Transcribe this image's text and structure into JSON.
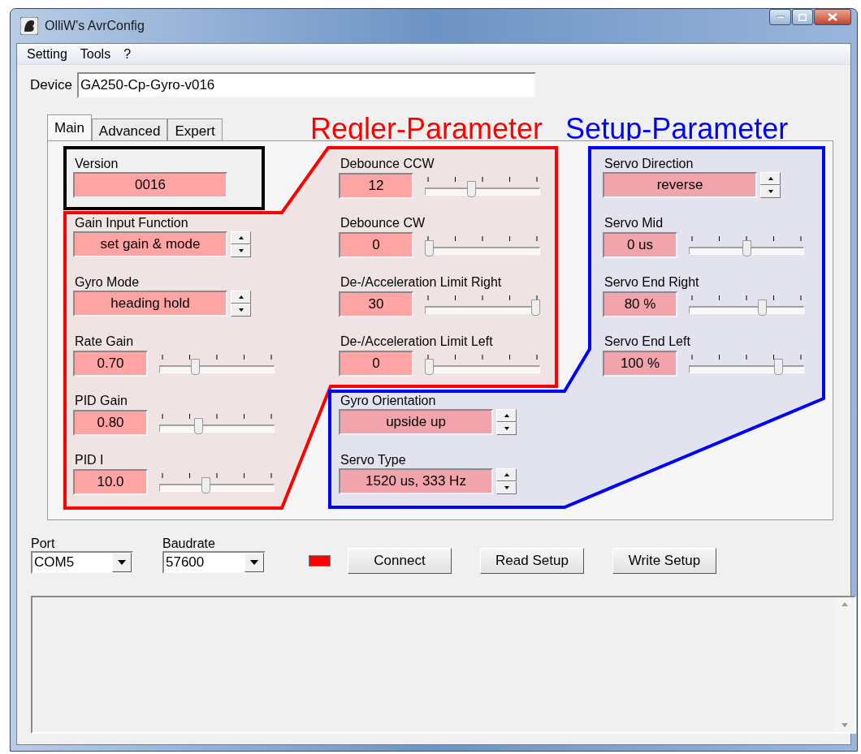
{
  "window": {
    "title": "OlliW's AvrConfig"
  },
  "menu": [
    "Setting",
    "Tools",
    "?"
  ],
  "device": {
    "label": "Device",
    "value": "GA250-Cp-Gyro-v016"
  },
  "tabs": [
    {
      "label": "Main",
      "selected": true
    },
    {
      "label": "Advanced",
      "selected": false
    },
    {
      "label": "Expert",
      "selected": false
    }
  ],
  "annotations": [
    {
      "text": "Regler-Parameter",
      "color": "#ff0000"
    },
    {
      "text": "Setup-Parameter",
      "color": "#0000ff"
    }
  ],
  "columns": [
    [
      {
        "label": "Version",
        "value": "0016",
        "kind": "display",
        "color": "#ffa4a4"
      },
      {
        "label": "Gain Input Function",
        "value": "set gain & mode",
        "kind": "spin",
        "color": "#ffa4a4"
      },
      {
        "label": "Gyro Mode",
        "value": "heading hold",
        "kind": "spin",
        "color": "#ffa4a4"
      },
      {
        "label": "Rate Gain",
        "value": "0.70",
        "kind": "slider",
        "level": 0.3,
        "color": "#ffa4a4"
      },
      {
        "label": "PID Gain",
        "value": "0.80",
        "kind": "slider",
        "level": 0.33,
        "color": "#ffa4a4"
      },
      {
        "label": "PID I",
        "value": "10.0",
        "kind": "slider",
        "level": 0.4,
        "color": "#ffa4a4"
      }
    ],
    [
      {
        "label": "Debounce CCW",
        "value": "12",
        "kind": "slider",
        "level": 0.4,
        "color": "#ffa4a4"
      },
      {
        "label": "Debounce CW",
        "value": "0",
        "kind": "slider",
        "level": 0,
        "color": "#ffa4a4"
      },
      {
        "label": "De-/Acceleration Limit Right",
        "value": "30",
        "kind": "slider",
        "level": 1,
        "color": "#ffa4a4"
      },
      {
        "label": "De-/Acceleration Limit Left",
        "value": "0",
        "kind": "slider",
        "level": 0,
        "color": "#ffa4a4"
      },
      {
        "label": "Gyro Orientation",
        "value": "upside up",
        "kind": "spin",
        "color": "#f2a4ac"
      },
      {
        "label": "Servo Type",
        "value": "1520 us, 333 Hz",
        "kind": "spin",
        "color": "#f2a4ac"
      }
    ],
    [
      {
        "label": "Servo Direction",
        "value": "reverse",
        "kind": "spin",
        "color": "#f2a4ac"
      },
      {
        "label": "Servo Mid",
        "value": "0 us",
        "kind": "slider",
        "level": 0.5,
        "color": "#f2a4ac"
      },
      {
        "label": "Servo End Right",
        "value": "80 %",
        "kind": "slider",
        "level": 0.65,
        "color": "#f2a4ac"
      },
      {
        "label": "Servo End Left",
        "value": "100 %",
        "kind": "slider",
        "level": 0.8,
        "color": "#f2a4ac"
      }
    ]
  ],
  "port": {
    "label": "Port",
    "value": "COM5"
  },
  "baudrate": {
    "label": "Baudrate",
    "value": "57600"
  },
  "connected": false,
  "buttons": [
    "Connect",
    "Read Setup",
    "Write Setup"
  ]
}
